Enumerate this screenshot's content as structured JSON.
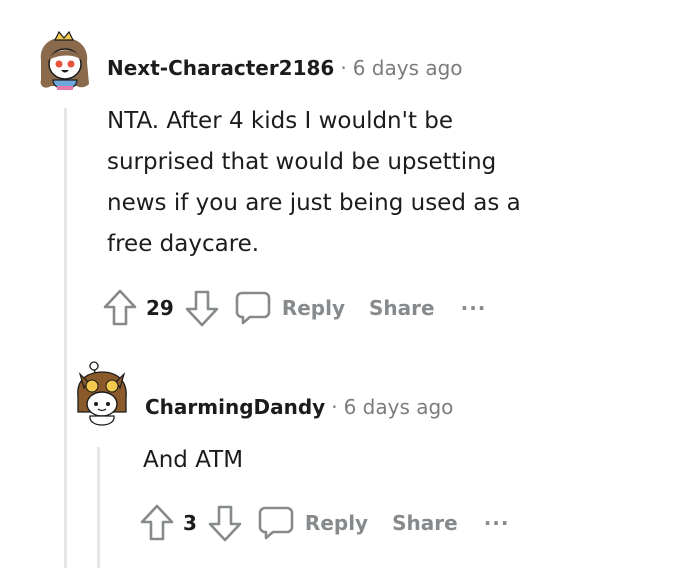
{
  "comments": [
    {
      "username": "Next-Character2186",
      "separator": "·",
      "time": "6 days ago",
      "lines": [
        "NTA. After 4 kids I wouldn't be",
        "surprised that would be upsetting",
        "news if you are just being used as a",
        "free daycare."
      ],
      "score": "29",
      "reply_label": "Reply",
      "share_label": "Share",
      "more_label": "···"
    },
    {
      "username": "CharmingDandy",
      "separator": "·",
      "time": "6 days ago",
      "lines": [
        "And ATM"
      ],
      "score": "3",
      "reply_label": "Reply",
      "share_label": "Share",
      "more_label": "···"
    }
  ],
  "icons": {
    "upvote": "upvote-arrow-icon",
    "downvote": "downvote-arrow-icon",
    "reply": "speech-bubble-icon",
    "avatar1": "snoo-avatar-crown",
    "avatar2": "snoo-avatar-owl"
  },
  "colors": {
    "username": "#1c1c1c",
    "meta": "#7c7c7c",
    "action": "#878a8c",
    "thread_line": "#e4e6e8"
  }
}
